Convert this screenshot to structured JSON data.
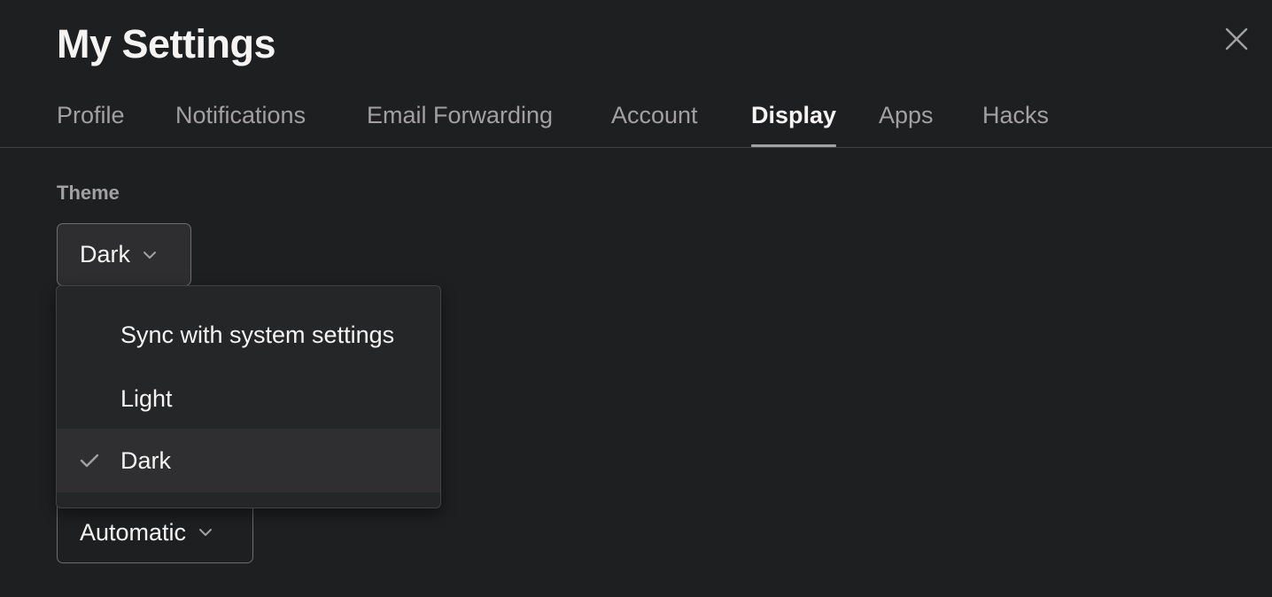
{
  "page": {
    "title": "My Settings"
  },
  "tabs": [
    {
      "label": "Profile",
      "active": false
    },
    {
      "label": "Notifications",
      "active": false
    },
    {
      "label": "Email Forwarding",
      "active": false
    },
    {
      "label": "Account",
      "active": false
    },
    {
      "label": "Display",
      "active": true
    },
    {
      "label": "Apps",
      "active": false
    },
    {
      "label": "Hacks",
      "active": false
    }
  ],
  "theme": {
    "label": "Theme",
    "selected": "Dark",
    "options": [
      {
        "label": "Sync with system settings",
        "checked": false
      },
      {
        "label": "Light",
        "checked": false
      },
      {
        "label": "Dark",
        "checked": true
      }
    ]
  },
  "second_select": {
    "selected": "Automatic"
  },
  "icons": {
    "close": "close-icon",
    "chevron": "chevron-down-icon",
    "check": "check-icon"
  },
  "colors": {
    "background": "#1e1f21",
    "text": "#f5f4f3",
    "muted_text": "#a2a0a2",
    "border": "#6d6e6f",
    "menu_selected": "#2f2f31"
  }
}
